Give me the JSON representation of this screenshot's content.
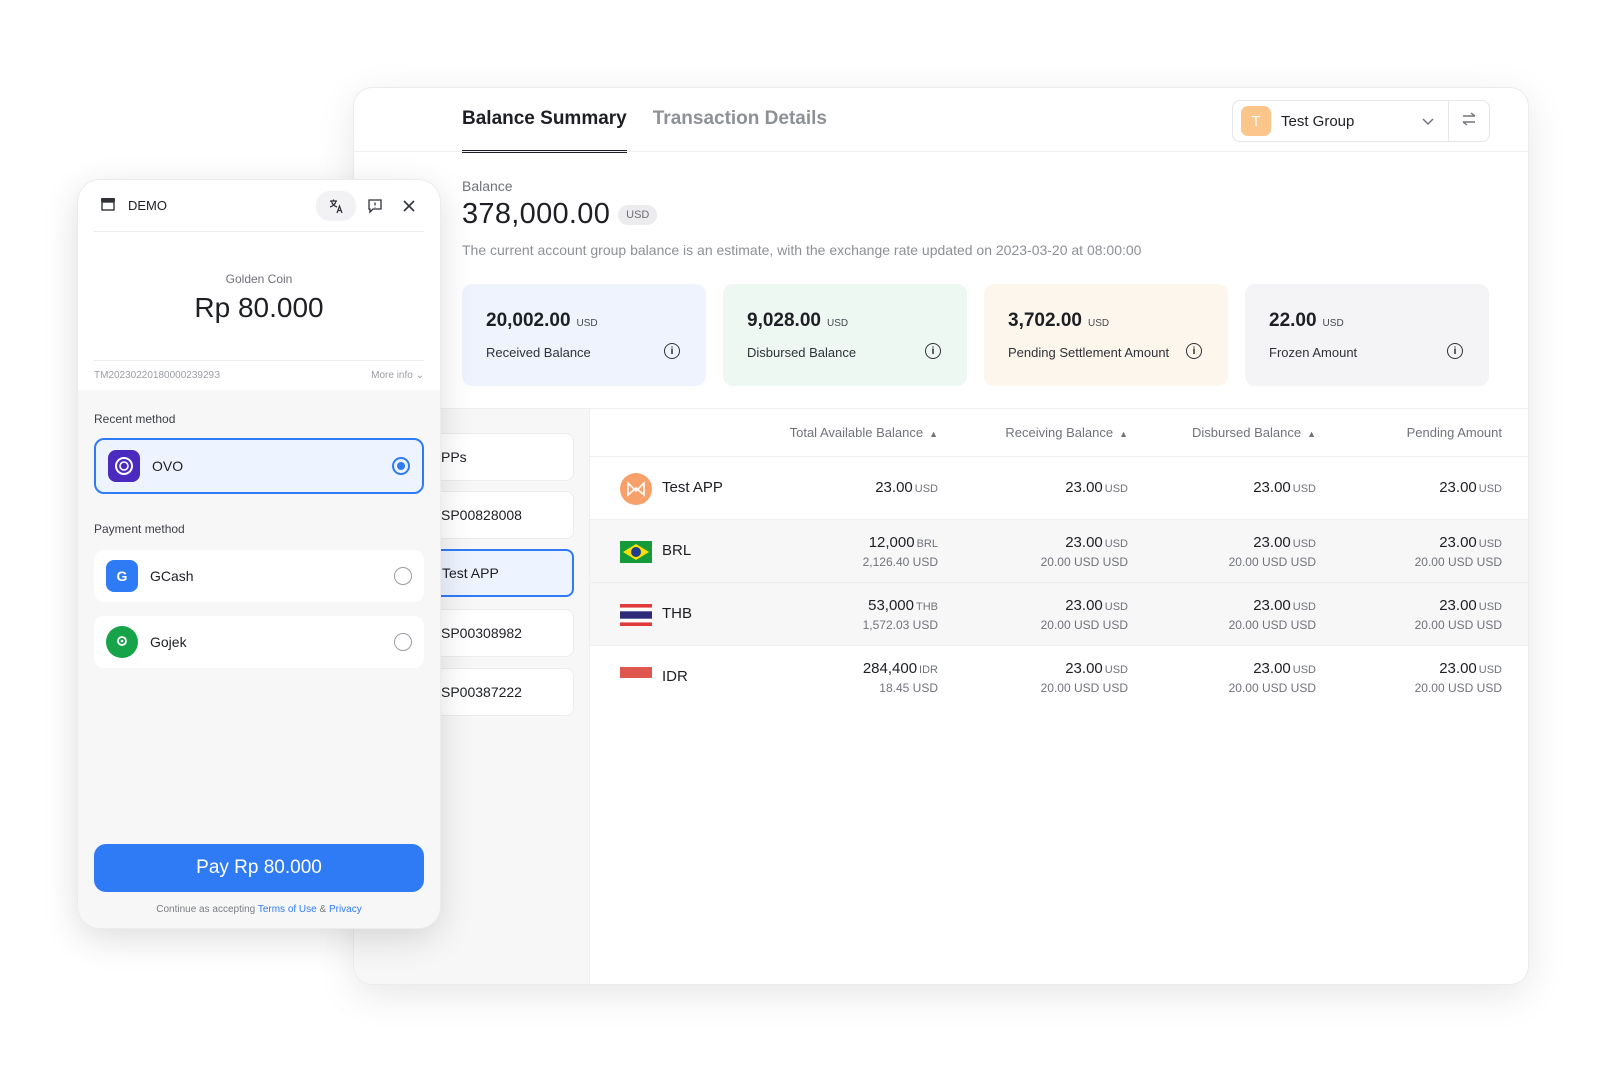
{
  "dashboard": {
    "tabs": [
      "Balance Summary",
      "Transaction Details"
    ],
    "group": {
      "avatar": "T",
      "name": "Test Group",
      "avatar_color": "#fcc58b"
    },
    "balance_label": "Balance",
    "balance_amount": "378,000.00",
    "balance_currency": "USD",
    "balance_note": "The current account group balance is an estimate, with the exchange rate updated on 2023-03-20 at 08:00:00",
    "cards": [
      {
        "value": "20,002.00",
        "currency": "USD",
        "label": "Received Balance",
        "color": "#eef3fd"
      },
      {
        "value": "9,028.00",
        "currency": "USD",
        "label": "Disbursed Balance",
        "color": "#ecf8f1"
      },
      {
        "value": "3,702.00",
        "currency": "USD",
        "label": "Pending Settlement Amount",
        "color": "#fdf6ec"
      },
      {
        "value": "22.00",
        "currency": "USD",
        "label": "Frozen Amount",
        "color": "#f4f4f6"
      }
    ],
    "app_list": [
      "PPs",
      "SP00828008",
      "Test APP",
      "SP00308982",
      "SP00387222"
    ],
    "selected_app": "Test APP",
    "columns": [
      "Total Available Balance",
      "Receiving Balance",
      "Disbursed Balance",
      "Pending Amount"
    ],
    "rows": [
      {
        "name": "Test APP",
        "icon": "app-logo-icon",
        "cells": [
          {
            "v": "23.00",
            "c": "USD",
            "sub": ""
          },
          {
            "v": "23.00",
            "c": "USD",
            "sub": ""
          },
          {
            "v": "23.00",
            "c": "USD",
            "sub": ""
          },
          {
            "v": "23.00",
            "c": "USD",
            "sub": ""
          }
        ]
      },
      {
        "name": "BRL",
        "icon": "brazil-flag-icon",
        "cells": [
          {
            "v": "12,000",
            "c": "BRL",
            "sub": "2,126.40 USD"
          },
          {
            "v": "23.00",
            "c": "USD",
            "sub": "20.00 USD USD"
          },
          {
            "v": "23.00",
            "c": "USD",
            "sub": "20.00 USD USD"
          },
          {
            "v": "23.00",
            "c": "USD",
            "sub": "20.00 USD USD"
          }
        ]
      },
      {
        "name": "THB",
        "icon": "thailand-flag-icon",
        "cells": [
          {
            "v": "53,000",
            "c": "THB",
            "sub": "1,572.03 USD"
          },
          {
            "v": "23.00",
            "c": "USD",
            "sub": "20.00 USD USD"
          },
          {
            "v": "23.00",
            "c": "USD",
            "sub": "20.00 USD USD"
          },
          {
            "v": "23.00",
            "c": "USD",
            "sub": "20.00 USD USD"
          }
        ]
      },
      {
        "name": "IDR",
        "icon": "indonesia-flag-icon",
        "cells": [
          {
            "v": "284,400",
            "c": "IDR",
            "sub": "18.45 USD"
          },
          {
            "v": "23.00",
            "c": "USD",
            "sub": "20.00 USD USD"
          },
          {
            "v": "23.00",
            "c": "USD",
            "sub": "20.00 USD USD"
          },
          {
            "v": "23.00",
            "c": "USD",
            "sub": "20.00 USD USD"
          }
        ]
      }
    ]
  },
  "checkout": {
    "store_name": "DEMO",
    "product": "Golden Coin",
    "price": "Rp 80.000",
    "order_id": "TM2023022018000023929З",
    "more_info": "More info",
    "recent_label": "Recent method",
    "payment_label": "Payment method",
    "recent": {
      "name": "OVO",
      "color": "#4b2bbf"
    },
    "methods": [
      {
        "name": "GCash",
        "color": "#2f7bf6",
        "glyph": "G"
      },
      {
        "name": "Gojek",
        "color": "#16a34a",
        "glyph": "◎"
      }
    ],
    "pay_button": "Pay Rp 80.000",
    "terms_prefix": "Continue as accepting",
    "terms_link": "Terms of Use",
    "terms_amp": "&",
    "privacy_link": "Privacy"
  },
  "colors": {
    "accent": "#2f7bf6",
    "text": "#1d1f24"
  }
}
